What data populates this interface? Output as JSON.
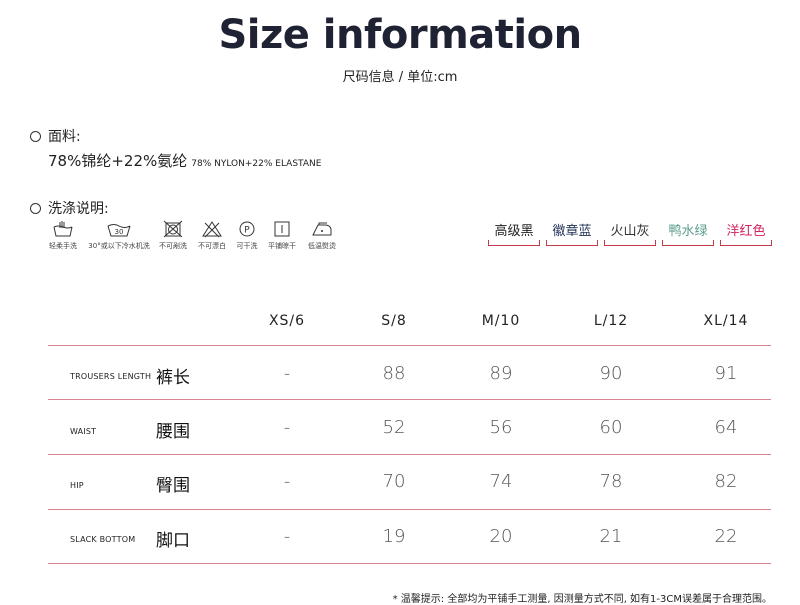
{
  "header": {
    "title": "Size information",
    "subtitle": "尺码信息 / 单位:cm"
  },
  "material": {
    "label": "面料:",
    "value_cn": "78%锦纶+22%氨纶",
    "value_en": "78% NYLON+22% ELASTANE"
  },
  "washing": {
    "label": "洗涤说明:",
    "icons": [
      {
        "icon": "hand-wash-icon",
        "label": "轻柔手洗",
        "text": ""
      },
      {
        "icon": "machine-wash-30-icon",
        "label": "30°或以下冷水机洗",
        "text": "30"
      },
      {
        "icon": "do-not-tumble-dry-icon",
        "label": "不可剐洗",
        "text": ""
      },
      {
        "icon": "do-not-bleach-icon",
        "label": "不可漂白",
        "text": ""
      },
      {
        "icon": "dry-clean-p-icon",
        "label": "可干洗",
        "text": "P"
      },
      {
        "icon": "flat-dry-icon",
        "label": "平铺晾干",
        "text": ""
      },
      {
        "icon": "low-iron-icon",
        "label": "低温熨烫",
        "text": ""
      }
    ]
  },
  "colors": [
    {
      "name": "高级黑",
      "color": "#222222"
    },
    {
      "name": "徽章蓝",
      "color": "#1f2f55"
    },
    {
      "name": "火山灰",
      "color": "#333333"
    },
    {
      "name": "鸭水绿",
      "color": "#5a9c8e"
    },
    {
      "name": "洋红色",
      "color": "#d2245f"
    }
  ],
  "table": {
    "headers": [
      "XS/6",
      "S/8",
      "M/10",
      "L/12",
      "XL/14"
    ],
    "rows": [
      {
        "en": "TROUSERS LENGTH",
        "cn": "裤长",
        "values": [
          "-",
          "88",
          "89",
          "90",
          "91"
        ]
      },
      {
        "en": "WAIST",
        "cn": "腰围",
        "values": [
          "-",
          "52",
          "56",
          "60",
          "64"
        ]
      },
      {
        "en": "HIP",
        "cn": "臀围",
        "values": [
          "-",
          "70",
          "74",
          "78",
          "82"
        ]
      },
      {
        "en": "SLACK BOTTOM",
        "cn": "脚口",
        "values": [
          "-",
          "19",
          "20",
          "21",
          "22"
        ]
      }
    ]
  },
  "note": "* 温馨提示: 全部均为平铺手工测量, 因测量方式不同, 如有1-3CM误差属于合理范围。",
  "accent_color": "#c33b4a"
}
